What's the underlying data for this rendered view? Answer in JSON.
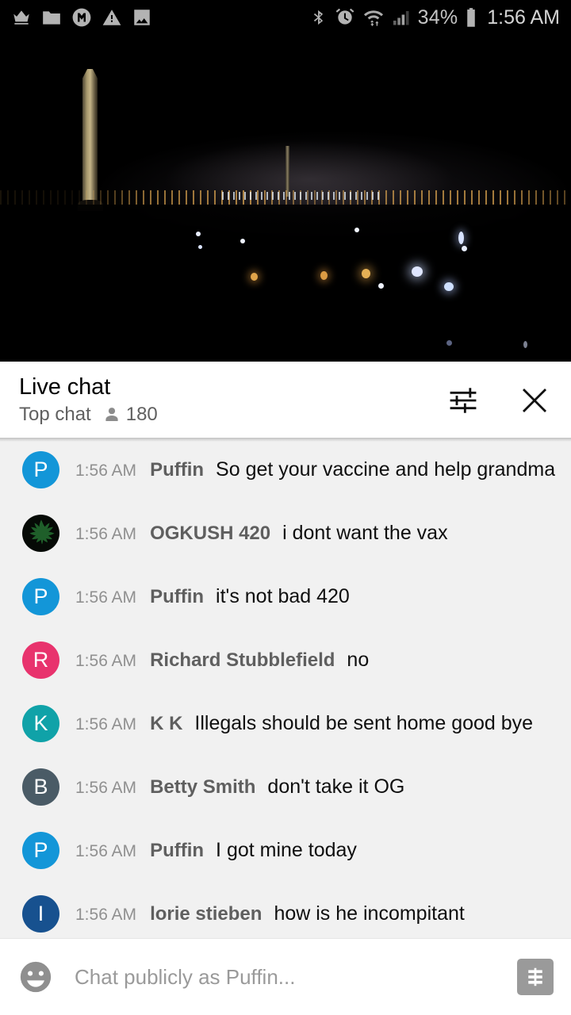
{
  "status_bar": {
    "left_icons": [
      "crown-icon",
      "folder-icon",
      "m-badge-icon",
      "warning-icon",
      "image-icon"
    ],
    "right_icons": [
      "bluetooth-icon",
      "alarm-icon",
      "wifi-icon",
      "signal-icon",
      "battery-icon"
    ],
    "battery_percent": "34%",
    "time": "1:56 AM"
  },
  "video": {
    "scene_description": "Washington Monument at night",
    "progress_color": "#e62117"
  },
  "chat_header": {
    "title": "Live chat",
    "subtitle": "Top chat",
    "viewer_count": "180",
    "viewers_icon": "person-icon",
    "settings_icon": "tune-icon",
    "close_icon": "close-icon"
  },
  "messages": [
    {
      "avatar_letter": "P",
      "avatar_color": "#1396d8",
      "avatar_type": "letter",
      "time": "1:56 AM",
      "author": "Puffin",
      "text": "So get your vaccine and help grandma"
    },
    {
      "avatar_letter": "",
      "avatar_color": "#060a06",
      "avatar_type": "leaf",
      "time": "1:56 AM",
      "author": "OGKUSH 420",
      "text": "i dont want the vax"
    },
    {
      "avatar_letter": "P",
      "avatar_color": "#1396d8",
      "avatar_type": "letter",
      "time": "1:56 AM",
      "author": "Puffin",
      "text": "it's not bad 420"
    },
    {
      "avatar_letter": "R",
      "avatar_color": "#e8336d",
      "avatar_type": "letter",
      "time": "1:56 AM",
      "author": "Richard Stubblefield",
      "text": "no"
    },
    {
      "avatar_letter": "K",
      "avatar_color": "#10a2a8",
      "avatar_type": "letter",
      "time": "1:56 AM",
      "author": "K K",
      "text": "Illegals should be sent home good bye"
    },
    {
      "avatar_letter": "B",
      "avatar_color": "#4a5b66",
      "avatar_type": "letter",
      "time": "1:56 AM",
      "author": "Betty Smith",
      "text": "don't take it OG"
    },
    {
      "avatar_letter": "P",
      "avatar_color": "#1396d8",
      "avatar_type": "letter",
      "time": "1:56 AM",
      "author": "Puffin",
      "text": "I got mine today"
    },
    {
      "avatar_letter": "I",
      "avatar_color": "#17518f",
      "avatar_type": "letter",
      "time": "1:56 AM",
      "author": "lorie stieben",
      "text": "how is he incompitant"
    }
  ],
  "input_bar": {
    "emoji_icon": "emoji-smiley-icon",
    "placeholder": "Chat publicly as Puffin...",
    "value": "",
    "superchat_icon": "dollar-bill-icon"
  }
}
